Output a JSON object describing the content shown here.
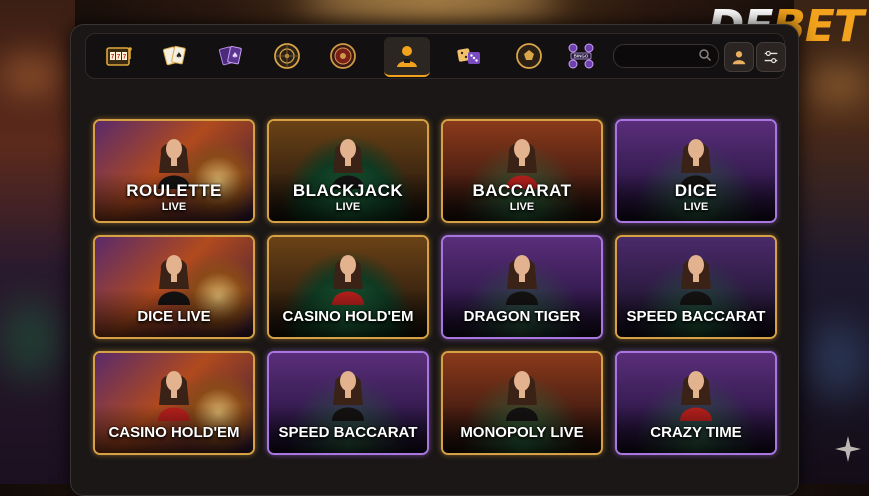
{
  "brand": {
    "part1": "DE",
    "part2": "BET"
  },
  "toolbar": {
    "tools": [
      {
        "icon": "slot-machine-icon"
      },
      {
        "icon": "playing-cards-icon"
      },
      {
        "icon": "purple-cards-icon"
      },
      {
        "icon": "roulette-wheel-icon"
      },
      {
        "icon": "roulette-red-icon"
      },
      {
        "icon": "live-dealer-icon",
        "active": true
      },
      {
        "icon": "dice-icon"
      },
      {
        "icon": "sports-ball-icon"
      },
      {
        "icon": "bingo-icon",
        "text": "BINGO"
      }
    ],
    "search_placeholder": ""
  },
  "games": [
    {
      "title": "ROULETTE",
      "subtitle": "LIVE",
      "theme": "orange"
    },
    {
      "title": "BLACKJACK",
      "subtitle": "LIVE",
      "theme": "orange"
    },
    {
      "title": "BACCARAT",
      "subtitle": "LIVE",
      "theme": "orange"
    },
    {
      "title": "DICE",
      "subtitle": "LIVE",
      "theme": "purple"
    },
    {
      "title": "DICE LIVE",
      "subtitle": "",
      "theme": "orange"
    },
    {
      "title": "CASINO HOLD'EM",
      "subtitle": "",
      "theme": "orange"
    },
    {
      "title": "DRAGON TIGER",
      "subtitle": "",
      "theme": "purple"
    },
    {
      "title": "SPEED BACCARAT",
      "subtitle": "",
      "theme": "orange"
    },
    {
      "title": "CASINO HOLD'EM",
      "subtitle": "",
      "theme": "orange"
    },
    {
      "title": "SPEED BACCARAT",
      "subtitle": "",
      "theme": "purple"
    },
    {
      "title": "MONOPOLY LIVE",
      "subtitle": "",
      "theme": "orange"
    },
    {
      "title": "CRAZY TIME",
      "subtitle": "",
      "theme": "purple"
    }
  ],
  "colors": {
    "accent": "#f2a21c",
    "tile_border_gold": "#d6a044",
    "tile_border_purple": "#a975e0"
  }
}
